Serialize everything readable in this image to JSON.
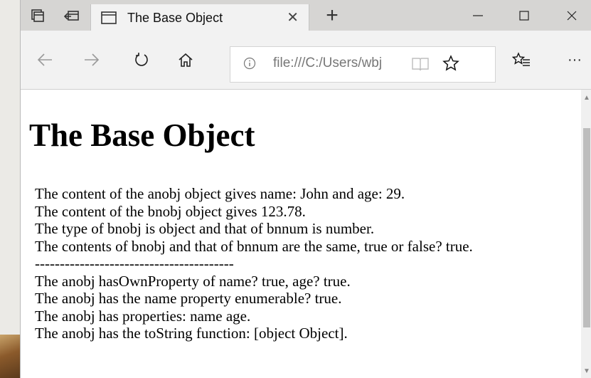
{
  "browser": {
    "tab_title": "The Base Object",
    "address": "file:///C:/Users/wbj",
    "more_label": "···"
  },
  "page": {
    "title": "The Base Object",
    "lines": [
      "The content of the anobj object gives name: John and age: 29.",
      "The content of the bnobj object gives 123.78.",
      "The type of bnobj is object and that of bnnum is number.",
      "The contents of bnobj and that of bnnum are the same, true or false? true.",
      "----------------------------------------",
      "The anobj hasOwnProperty of name? true, age? true.",
      "The anobj has the name property enumerable? true.",
      "The anobj has properties: name age.",
      "The anobj has the toString function: [object Object]."
    ]
  }
}
